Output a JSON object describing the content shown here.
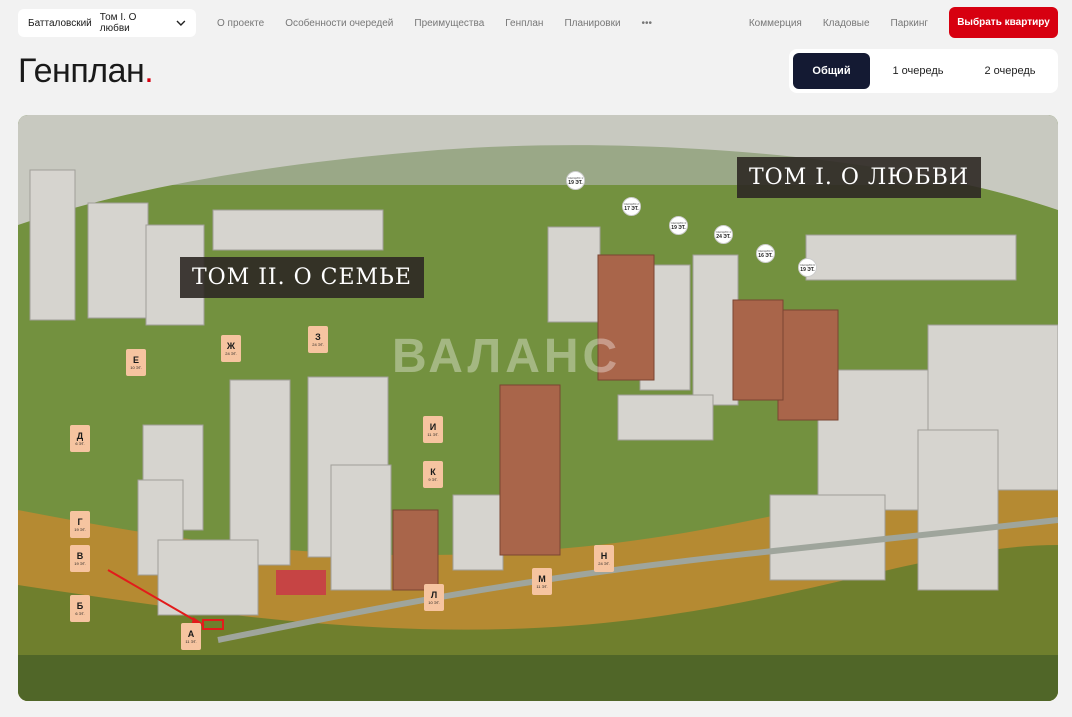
{
  "header": {
    "project_select": {
      "complex": "Батталовский",
      "tom": "Том I. О любви"
    },
    "nav": [
      "О проекте",
      "Особенности очередей",
      "Преимущества",
      "Генплан",
      "Планировки",
      "•••"
    ],
    "right_nav": [
      "Коммерция",
      "Кладовые",
      "Паркинг"
    ],
    "cta_label": "Выбрать квартиру"
  },
  "page": {
    "title": "Генплан",
    "title_dot": "."
  },
  "tabs": [
    "Общий",
    "1 очередь",
    "2 очередь"
  ],
  "active_tab": "Общий",
  "map": {
    "queue_labels": {
      "tom1": "ТОМ I. О ЛЮБВИ",
      "tom2": "ТОМ II. О СЕМЬЕ"
    },
    "watermark": "ВАЛАНС",
    "buildings": [
      {
        "id": "А",
        "floors": "11 ЭТ."
      },
      {
        "id": "Б",
        "floors": "6 ЭТ."
      },
      {
        "id": "В",
        "floors": "19 ЭТ."
      },
      {
        "id": "Г",
        "floors": "19 ЭТ."
      },
      {
        "id": "Д",
        "floors": "6 ЭТ."
      },
      {
        "id": "Е",
        "floors": "10 ЭТ."
      },
      {
        "id": "Ж",
        "floors": "24 ЭТ."
      },
      {
        "id": "З",
        "floors": "24 ЭТ."
      },
      {
        "id": "И",
        "floors": "11 ЭТ."
      },
      {
        "id": "К",
        "floors": "9 ЭТ."
      },
      {
        "id": "Л",
        "floors": "10 ЭТ."
      },
      {
        "id": "М",
        "floors": "11 ЭТ."
      },
      {
        "id": "Н",
        "floors": "24 ЭТ."
      }
    ],
    "sections": [
      {
        "label": "СЕКЦИЯ 1",
        "floors": "19 ЭТ."
      },
      {
        "label": "СЕКЦИЯ 2",
        "floors": "17 ЭТ."
      },
      {
        "label": "СЕКЦИЯ 3",
        "floors": "19 ЭТ."
      },
      {
        "label": "СЕКЦИЯ 4",
        "floors": "24 ЭТ."
      },
      {
        "label": "СЕКЦИЯ 5",
        "floors": "16 ЭТ."
      },
      {
        "label": "СЕКЦИЯ 6",
        "floors": "19 ЭТ."
      }
    ]
  },
  "colors": {
    "accent": "#d70010",
    "active_tab": "#141a33",
    "pin": "#f6c4a0"
  }
}
